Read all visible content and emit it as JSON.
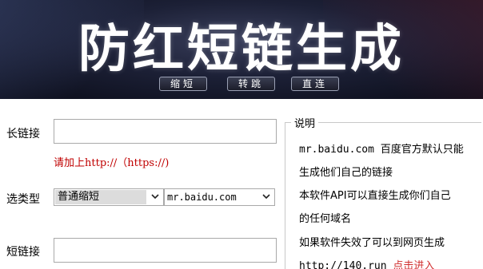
{
  "banner": {
    "title": "防红短链生成",
    "nav": [
      "缩短",
      "转跳",
      "直连"
    ]
  },
  "form": {
    "long_label": "长链接",
    "long_value": "",
    "hint": "请加上http://（https://)",
    "type_label": "选类型",
    "type_selected": "普通缩短",
    "domain_selected": "mr.baidu.com",
    "short_label": "短链接",
    "short_value": ""
  },
  "info": {
    "title": "说明",
    "line1": "mr.baidu.com 百度官方默认只能",
    "line2": "生成他们自己的链接",
    "line3": "本软件API可以直接生成你们自己",
    "line4": "的任何域名",
    "line5": "如果软件失效了可以到网页生成",
    "line6_prefix": "http://140.run ",
    "line6_link": "点击进入"
  },
  "icons": {
    "dropdown": "chevron-down-icon"
  }
}
